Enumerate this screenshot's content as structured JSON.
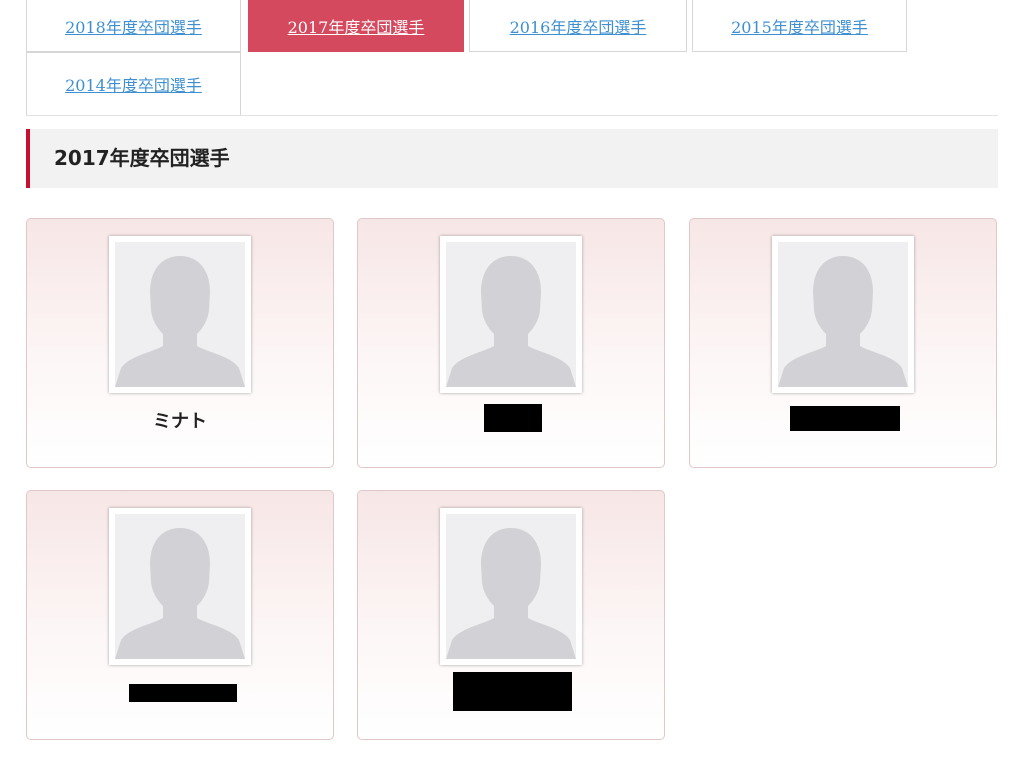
{
  "tabs": [
    {
      "label": "2018年度卒団選手",
      "active": false
    },
    {
      "label": "2017年度卒団選手",
      "active": true
    },
    {
      "label": "2016年度卒団選手",
      "active": false
    },
    {
      "label": "2015年度卒団選手",
      "active": false
    },
    {
      "label": "2014年度卒団選手",
      "active": false
    }
  ],
  "section": {
    "title": "2017年度卒団選手"
  },
  "players": [
    {
      "name": "ミナト",
      "redacted": false
    },
    {
      "name": "",
      "redacted": true
    },
    {
      "name": "",
      "redacted": true
    },
    {
      "name": "",
      "redacted": true
    },
    {
      "name": "",
      "redacted": true
    }
  ],
  "colors": {
    "accent": "#d5495f",
    "link": "#3d8fd1",
    "section_bar": "#c8102e"
  }
}
